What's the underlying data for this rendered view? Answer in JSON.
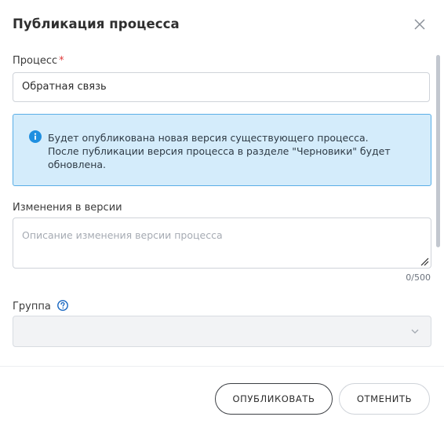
{
  "dialog": {
    "title": "Публикация процесса",
    "process": {
      "label": "Процесс",
      "required_mark": "*",
      "value": "Обратная связь"
    },
    "info": {
      "line1": "Будет опубликована новая версия существующего процесса.",
      "line2": "После публикации версия процесса в разделе \"Черновики\" будет",
      "line3": "обновлена."
    },
    "changes": {
      "label": "Изменения в версии",
      "placeholder": "Описание изменения версии процесса",
      "counter": "0/500"
    },
    "group": {
      "label": "Группа",
      "value": ""
    },
    "buttons": {
      "publish": "ОПУБЛИКОВАТЬ",
      "cancel": "ОТМЕНИТЬ"
    }
  },
  "colors": {
    "info_bg": "#d4ecfb",
    "info_border": "#5aaee6",
    "info_icon": "#1f8fe0",
    "required": "#e03b3b",
    "help_icon": "#1565c0"
  },
  "icons": {
    "close": "close-icon",
    "info": "info-icon",
    "help": "help-icon",
    "resize": "resize-handle-icon",
    "dropdown": "chevron-down-icon"
  }
}
